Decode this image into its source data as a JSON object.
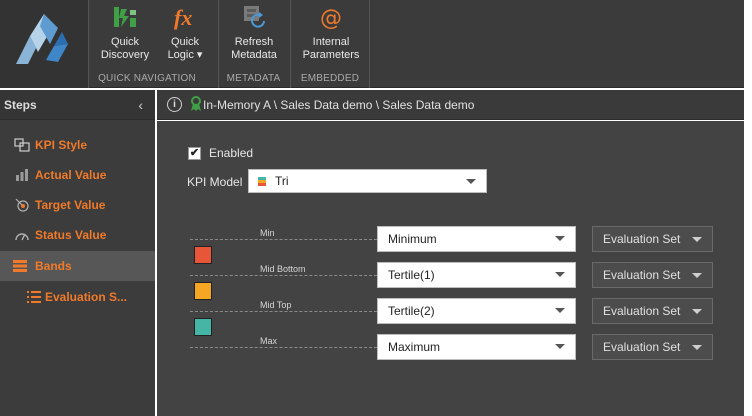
{
  "ribbon": {
    "groups": [
      {
        "label": "QUICK NAVIGATION",
        "buttons": [
          {
            "label": "Quick\nDiscovery",
            "icon": "quick-discovery-icon"
          },
          {
            "label": "Quick\nLogic ▾",
            "icon": "fx-icon"
          }
        ]
      },
      {
        "label": "METADATA",
        "buttons": [
          {
            "label": "Refresh\nMetadata",
            "icon": "refresh-metadata-icon"
          }
        ]
      },
      {
        "label": "EMBEDDED",
        "buttons": [
          {
            "label": "Internal\nParameters",
            "icon": "at-sign-icon"
          }
        ]
      }
    ]
  },
  "steps": {
    "title": "Steps",
    "items": [
      {
        "label": "KPI Style",
        "icon": "kpi-style-icon"
      },
      {
        "label": "Actual Value",
        "icon": "bar-chart-icon"
      },
      {
        "label": "Target Value",
        "icon": "target-icon"
      },
      {
        "label": "Status Value",
        "icon": "gauge-icon"
      },
      {
        "label": "Bands",
        "icon": "bands-icon",
        "selected": true
      },
      {
        "label": "Evaluation S...",
        "icon": "list-icon",
        "sub": true
      }
    ]
  },
  "breadcrumb": {
    "info_glyph": "i",
    "path": "In-Memory A \\ Sales Data demo \\ Sales Data demo"
  },
  "form": {
    "enabled_label": "Enabled",
    "enabled_checked": true,
    "check_glyph": "✔",
    "kpi_model_label": "KPI Model",
    "kpi_model_value": "Tri",
    "bands": [
      {
        "label": "Min",
        "value": "Minimum",
        "evaluation": "Evaluation Set"
      },
      {
        "label": "Mid Bottom",
        "value": "Tertile(1)",
        "evaluation": "Evaluation Set"
      },
      {
        "label": "Mid Top",
        "value": "Tertile(2)",
        "evaluation": "Evaluation Set"
      },
      {
        "label": "Max",
        "value": "Maximum",
        "evaluation": "Evaluation Set"
      }
    ],
    "swatch_colors": [
      "#e8563a",
      "#f5a623",
      "#45b5a6"
    ]
  },
  "colors": {
    "accent_orange": "#f07a2a",
    "ribbon_bg": "#3b3b3b",
    "panel_bg": "#434343"
  }
}
